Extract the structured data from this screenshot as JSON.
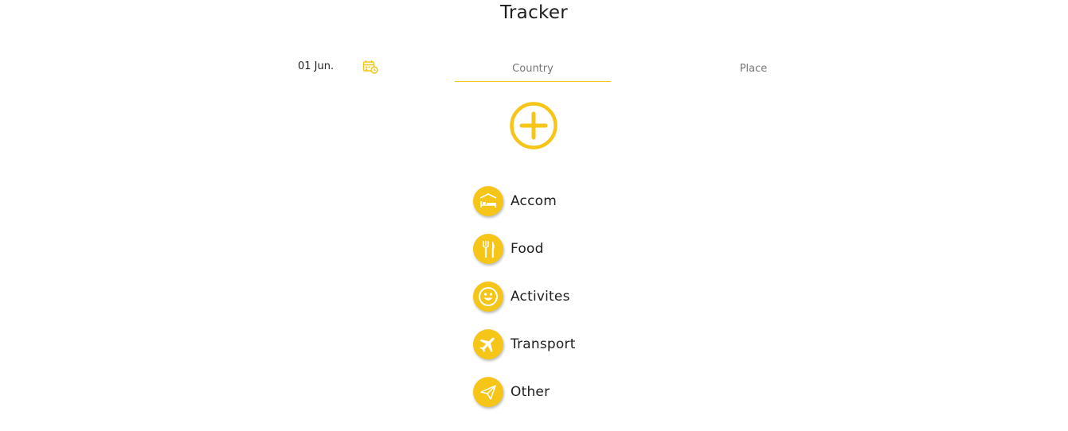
{
  "header": {
    "title": "Tracker"
  },
  "filters": {
    "date": "01 Jun.",
    "country_placeholder": "Country",
    "place_placeholder": "Place"
  },
  "icons": {
    "calendar": "calendar-icon",
    "add": "plus-circle-icon"
  },
  "categories": [
    {
      "label": "Accom",
      "icon": "bed-icon"
    },
    {
      "label": "Food",
      "icon": "fork-knife-icon"
    },
    {
      "label": "Activites",
      "icon": "smiley-icon"
    },
    {
      "label": "Transport",
      "icon": "airplane-icon"
    },
    {
      "label": "Other",
      "icon": "paper-plane-icon"
    }
  ],
  "colors": {
    "accent": "#f5c518",
    "text": "#1e1e1e",
    "muted": "#777777"
  }
}
